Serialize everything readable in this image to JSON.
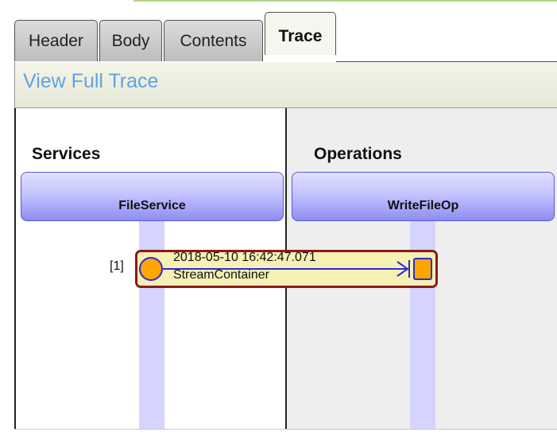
{
  "tabs": [
    {
      "label": "Header",
      "active": false
    },
    {
      "label": "Body",
      "active": false
    },
    {
      "label": "Contents",
      "active": false
    },
    {
      "label": "Trace",
      "active": true
    }
  ],
  "action_bar": {
    "view_full_trace": "View Full Trace"
  },
  "columns": {
    "services": "Services",
    "operations": "Operations"
  },
  "lifelines": {
    "service": "FileService",
    "operation": "WriteFileOp"
  },
  "message": {
    "index": "[1]",
    "timestamp": "2018-05-10 16:42:47.071",
    "payload": "StreamContainer"
  },
  "colors": {
    "link": "#5ea3e2",
    "lifeline": "#d4d4ff",
    "message_border": "#8b1a1a",
    "message_fill": "#f6f0b4",
    "start_circle": "#ffa500",
    "end_square": "#ffa500",
    "arrow": "#2b2bd8"
  }
}
